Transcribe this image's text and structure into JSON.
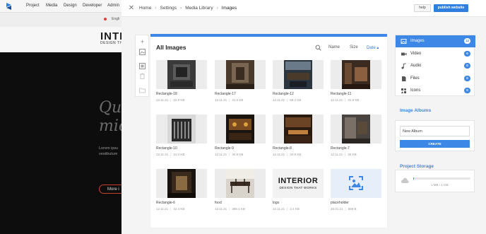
{
  "background": {
    "nav": [
      "Project",
      "Media",
      "Design",
      "Developer",
      "Admin"
    ],
    "language": "Engli",
    "hero_title": "INTE",
    "hero_subtitle": "DESIGN TH",
    "script_text_1": "Qu",
    "script_text_2": "mic",
    "lorem_1": "Lorem ipsu",
    "lorem_2": "vestibulum",
    "more_button": "More i"
  },
  "header": {
    "breadcrumbs": [
      "Home",
      "Settings",
      "Media Library",
      "Images"
    ],
    "help_label": "help",
    "publish_label": "publish website"
  },
  "main": {
    "title": "All Images",
    "sort_options": [
      "Name",
      "Size",
      "Date"
    ],
    "active_sort": "Date",
    "items": [
      {
        "name": "Rectangle-18",
        "date": "12.11.21",
        "size": "22.9 KB",
        "thumb": "room-dark"
      },
      {
        "name": "Rectangle-17",
        "date": "12.11.21",
        "size": "41.5 KB",
        "thumb": "room-wood"
      },
      {
        "name": "Rectangle-12",
        "date": "12.11.21",
        "size": "58.2 KB",
        "thumb": "room-blue"
      },
      {
        "name": "Rectangle-11",
        "date": "12.11.21",
        "size": "31.9 KB",
        "thumb": "room-brown"
      },
      {
        "name": "Rectangle-10",
        "date": "12.11.21",
        "size": "31.0 KB",
        "thumb": "room-stairs"
      },
      {
        "name": "Rectangle-9",
        "date": "12.11.21",
        "size": "30.8 KB",
        "thumb": "room-orange"
      },
      {
        "name": "Rectangle-8",
        "date": "12.11.21",
        "size": "20.8 KB",
        "thumb": "room-bar"
      },
      {
        "name": "Rectangle-7",
        "date": "12.11.21",
        "size": "26 KB",
        "thumb": "room-gray"
      },
      {
        "name": "Rectangle-6",
        "date": "12.11.21",
        "size": "42.4 KB",
        "thumb": "room-black"
      },
      {
        "name": "food",
        "date": "12.11.21",
        "size": "385.1 KB",
        "thumb": "room-dining"
      },
      {
        "name": "logo",
        "date": "12.11.21",
        "size": "2.4 KB",
        "thumb": "logo"
      },
      {
        "name": "placeholder",
        "date": "26.01.21",
        "size": "668 B",
        "thumb": "placeholder"
      }
    ],
    "logo_text_1": "INTERIOR",
    "logo_text_2": "DESIGN THAT WORKS"
  },
  "sidebar": {
    "items": [
      {
        "label": "Images",
        "count": "12",
        "icon": "image-icon"
      },
      {
        "label": "Video",
        "count": "0",
        "icon": "video-icon"
      },
      {
        "label": "Audio",
        "count": "0",
        "icon": "audio-icon"
      },
      {
        "label": "Files",
        "count": "0",
        "icon": "file-icon"
      },
      {
        "label": "Icons",
        "count": "0",
        "icon": "icons-icon"
      }
    ],
    "albums_title": "Image Albums",
    "album_input_value": "New Album",
    "create_label": "CREATE",
    "storage_title": "Project Storage",
    "storage_text": "1 MB / 1 GB",
    "storage_fraction": 0.001
  },
  "colors": {
    "accent": "#3d87e6",
    "publish": "#2f7fe0"
  }
}
